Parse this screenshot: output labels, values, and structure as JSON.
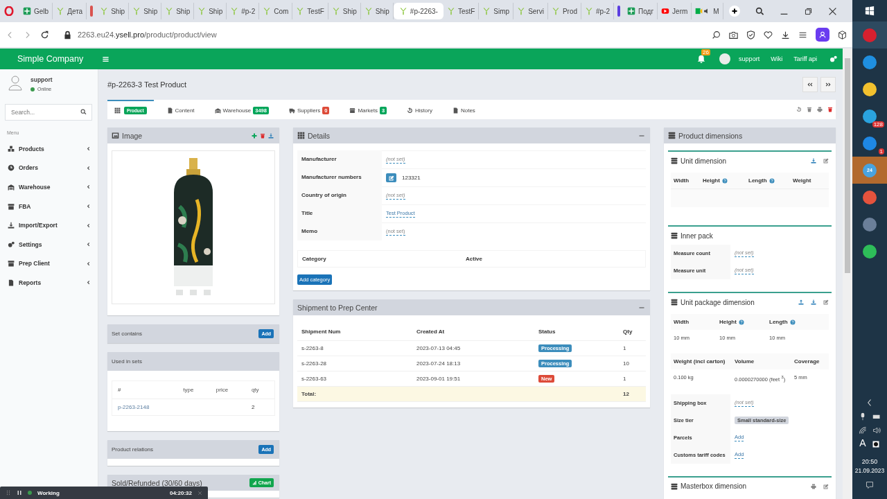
{
  "browser": {
    "tabs": [
      {
        "label": "Gelb",
        "kind": "sheets",
        "selected": false
      },
      {
        "label": "Дета",
        "kind": "ysell",
        "selected": false
      },
      {
        "label": "Ship",
        "kind": "ysell",
        "selected": false
      },
      {
        "label": "Ship",
        "kind": "ysell",
        "selected": false
      },
      {
        "label": "Ship",
        "kind": "ysell",
        "selected": false
      },
      {
        "label": "Ship",
        "kind": "ysell",
        "selected": false
      },
      {
        "label": "#p-2",
        "kind": "ysell",
        "selected": false
      },
      {
        "label": "Com",
        "kind": "ysell",
        "selected": false
      },
      {
        "label": "TestF",
        "kind": "ysell",
        "selected": false
      },
      {
        "label": "Ship",
        "kind": "ysell",
        "selected": false
      },
      {
        "label": "Ship",
        "kind": "ysell",
        "selected": false
      },
      {
        "label": "#p-2263-",
        "kind": "ysell",
        "selected": true
      },
      {
        "label": "TestF",
        "kind": "ysell",
        "selected": false
      },
      {
        "label": "Simp",
        "kind": "ysell",
        "selected": false
      },
      {
        "label": "Servi",
        "kind": "ysell",
        "selected": false
      },
      {
        "label": "Prod",
        "kind": "ysell",
        "selected": false
      },
      {
        "label": "#p-2",
        "kind": "ysell",
        "selected": false
      },
      {
        "label": "Подг",
        "kind": "sheets",
        "selected": false
      },
      {
        "label": "Jerm",
        "kind": "youtube",
        "selected": false
      },
      {
        "label": "M",
        "kind": "meet",
        "selected": false
      }
    ],
    "address": "2263.eu24.**ysell.pro**/product/product/view"
  },
  "header": {
    "brand": "Simple Company",
    "notifications": "26",
    "user": "support",
    "links": [
      "Wiki",
      "Tariff api"
    ]
  },
  "sidebar": {
    "user": {
      "name": "support",
      "status": "Online"
    },
    "search": {
      "placeholder": "Search..."
    },
    "menu_label": "Menu",
    "items": [
      "Products",
      "Orders",
      "Warehouse",
      "FBA",
      "Import/Export",
      "Settings",
      "Prep Client",
      "Reports"
    ]
  },
  "title": "#p-2263-3 Test Product",
  "tabs": [
    {
      "label": "Product",
      "selected": true
    },
    {
      "label": "Content",
      "selected": false
    },
    {
      "label": "Warehouse",
      "badge": "3498",
      "color": "#00a65a",
      "selected": false
    },
    {
      "label": "Suppliers",
      "badge": "0",
      "color": "#dd4b39",
      "selected": false
    },
    {
      "label": "Markets",
      "badge": "3",
      "color": "#00a65a",
      "selected": false
    },
    {
      "label": "History",
      "selected": false
    },
    {
      "label": "Notes",
      "selected": false
    }
  ],
  "image_panel": {
    "title": "Image"
  },
  "set_contains": {
    "title": "Set contains",
    "button": "Add"
  },
  "used_in_sets": {
    "title": "Used in sets",
    "columns": [
      "#",
      "type",
      "price",
      "qty"
    ],
    "rows": [
      [
        "p-2263-2148",
        "",
        "",
        "2"
      ]
    ]
  },
  "product_relations": {
    "title": "Product relations",
    "button": "Add"
  },
  "sold_refunded": {
    "title": "Sold/Refunded (30/60 days)",
    "button": "Chart"
  },
  "details": {
    "title": "Details",
    "fields": [
      {
        "label": "Manufacturer",
        "value": "(not set)",
        "kind": "unset"
      },
      {
        "label": "Manufacturer numbers",
        "value": "123321",
        "kind": "numbers"
      },
      {
        "label": "Country of origin",
        "value": "(not set)",
        "kind": "unset"
      },
      {
        "label": "Title",
        "value": "Test Product",
        "kind": "link"
      },
      {
        "label": "Memo",
        "value": "(not set)",
        "kind": "plain"
      }
    ],
    "category_columns": [
      "Category",
      "Active"
    ],
    "button": "Add category"
  },
  "shipments": {
    "title": "Shipment to Prep Center",
    "columns": [
      "Shipment Num",
      "Created At",
      "Status",
      "Qty"
    ],
    "rows": [
      {
        "num": "s-2263-8",
        "created": "2023-07-13 04:45",
        "status": "Processing",
        "color": "#3c8dbc",
        "qty": "1"
      },
      {
        "num": "s-2263-28",
        "created": "2023-07-24 18:13",
        "status": "Processing",
        "color": "#3c8dbc",
        "qty": "10"
      },
      {
        "num": "s-2263-63",
        "created": "2023-09-01 19:51",
        "status": "New",
        "color": "#dd4b39",
        "qty": "1"
      }
    ],
    "total_label": "Total:",
    "total": "12"
  },
  "dimensions": {
    "title": "Product dimensions",
    "unit": {
      "title": "Unit dimension",
      "columns": [
        {
          "label": "Width",
          "help": false
        },
        {
          "label": "Height",
          "help": true
        },
        {
          "label": "Length",
          "help": true
        },
        {
          "label": "Weight",
          "help": false
        }
      ]
    },
    "inner": {
      "title": "Inner pack",
      "fields": [
        {
          "label": "Measure count",
          "value": "(not set)"
        },
        {
          "label": "Measure unit",
          "value": "(not set)"
        }
      ]
    },
    "package": {
      "title": "Unit package dimension",
      "columns": [
        {
          "label": "Width",
          "help": false
        },
        {
          "label": "Height",
          "help": true
        },
        {
          "label": "Length",
          "help": true
        }
      ],
      "values": [
        "10 mm",
        "10 mm",
        "10 mm"
      ],
      "columns2": [
        "Weight (incl carton)",
        "Volume",
        "Coverage"
      ],
      "values2": [
        "0.100 kg",
        "0.0000270000 (feet $^{3}$)",
        "5 mm"
      ],
      "fields": [
        {
          "label": "Shipping box",
          "value": "(not set)",
          "kind": "unset"
        },
        {
          "label": "Size tier",
          "value": "Small standard-size",
          "kind": "tag"
        },
        {
          "label": "Parcels",
          "value": "Add",
          "kind": "link"
        },
        {
          "label": "Customs tariff codes",
          "value": "Add",
          "kind": "link"
        }
      ]
    },
    "masterbox": {
      "title": "Masterbox dimension"
    }
  },
  "timer": {
    "status": "Working",
    "time": "04:20:32"
  },
  "taskbar": {
    "apps": [
      {
        "selected": true
      },
      {
        "selected": false
      },
      {
        "selected": false
      },
      {
        "selected": false,
        "badge": "128"
      },
      {
        "selected": false,
        "badge": "1"
      },
      {
        "selected": true,
        "text": "24"
      },
      {
        "selected": false
      },
      {
        "selected": false
      },
      {
        "selected": false
      }
    ],
    "language": "A",
    "time": "20:50",
    "date": "21.09.2023"
  }
}
